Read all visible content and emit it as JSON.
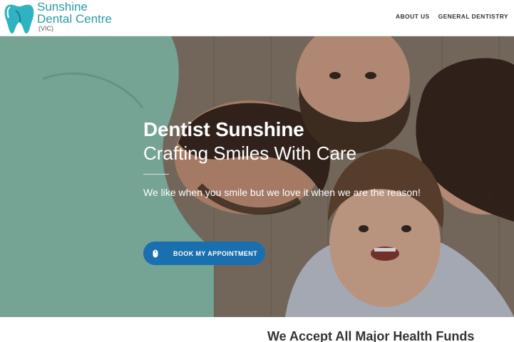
{
  "brand": {
    "line1": "Sunshine",
    "line2": "Dental Centre",
    "line3": "(VIC)",
    "color": "#2a9ba8"
  },
  "nav": {
    "items": [
      {
        "label": "ABOUT US"
      },
      {
        "label": "GENERAL DENTISTRY"
      }
    ]
  },
  "hero": {
    "title": "Dentist Sunshine",
    "subtitle": "Crafting Smiles With Care",
    "tagline": "We like when you smile but we love it when we are the reason!",
    "cta_label": "BOOK MY APPOINTMENT",
    "cta_icon": "mouse-icon",
    "cta_color": "#1a6fae",
    "image": "family-lying-in-circle-smiling"
  },
  "funds": {
    "heading": "We Accept All Major Health Funds"
  }
}
